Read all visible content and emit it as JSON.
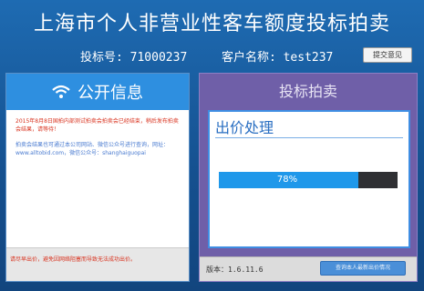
{
  "header": {
    "title": "上海市个人非营业性客车额度投标拍卖",
    "bid_no_label": "投标号:",
    "bid_no": "71000237",
    "client_label": "客户名称:",
    "client_name": "test237",
    "feedback_button": "提交意见"
  },
  "public_info": {
    "title": "公开信息",
    "messages": [
      "2015年8月8日国拍内部测试拍卖会拍卖会已经结束，稍后发布拍卖会结果，请等待！",
      "拍卖会结果也可通过本公司网站、微信公众号进行查询，网址：www.alltobid.com，微信公众号：shanghaiguopai"
    ],
    "warning": "请尽早出价，避免因网络阻塞而导致无法成功出价。"
  },
  "bidding": {
    "title": "投标拍卖",
    "version": "版本：1.6.11.6",
    "query_button": "查询本人最新出价情况"
  },
  "dialog": {
    "title": "出价处理",
    "progress_percent": 78,
    "progress_label": "78%"
  },
  "colors": {
    "accent": "#2e8fe0",
    "panel_purple": "#6f5fa8",
    "progress_fill": "#1f98ea",
    "warning_text": "#d9331f"
  },
  "icons": {
    "public_info": "wifi-icon"
  }
}
